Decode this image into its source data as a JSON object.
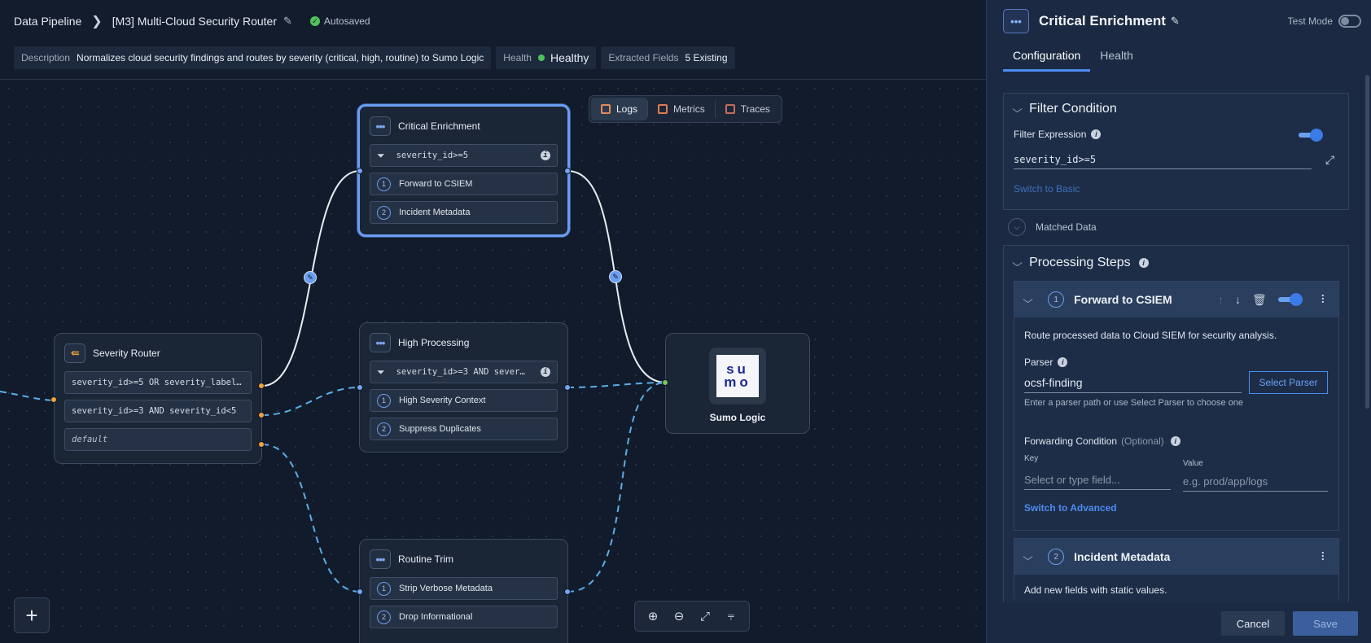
{
  "header": {
    "breadcrumb_root": "Data Pipeline",
    "pipeline_name": "[M3] Multi-Cloud Security Router",
    "autosaved": "Autosaved"
  },
  "info": {
    "description_label": "Description",
    "description": "Normalizes cloud security findings and routes by severity (critical, high, routine) to Sumo Logic",
    "health_label": "Health",
    "health_value": "Healthy",
    "fields_label": "Extracted Fields",
    "fields_value": "5 Existing"
  },
  "view_toggle": {
    "logs": "Logs",
    "metrics": "Metrics",
    "traces": "Traces",
    "selected": "Logs"
  },
  "nodes": {
    "critical": {
      "title": "Critical Enrichment",
      "filter": "severity_id>=5",
      "steps": [
        {
          "num": "1",
          "label": "Forward to CSIEM"
        },
        {
          "num": "2",
          "label": "Incident Metadata"
        }
      ]
    },
    "high": {
      "title": "High Processing",
      "filter": "severity_id>=3 AND sever…",
      "steps": [
        {
          "num": "1",
          "label": "High Severity Context"
        },
        {
          "num": "2",
          "label": "Suppress Duplicates"
        }
      ]
    },
    "routine": {
      "title": "Routine Trim",
      "steps": [
        {
          "num": "1",
          "label": "Strip Verbose Metadata"
        },
        {
          "num": "2",
          "label": "Drop Informational"
        }
      ]
    },
    "router": {
      "title": "Severity Router",
      "routes": [
        "severity_id>=5 OR severity_label…",
        "severity_id>=3 AND severity_id<5",
        "default"
      ]
    },
    "destination": {
      "logo_top": "su",
      "logo_bottom": "mo",
      "title": "Sumo Logic"
    }
  },
  "panel": {
    "title": "Critical Enrichment",
    "test_mode": "Test Mode",
    "tabs": [
      "Configuration",
      "Health"
    ],
    "filter_condition": {
      "title": "Filter Condition",
      "expression_label": "Filter Expression",
      "expression": "severity_id>=5",
      "switch_link": "Switch to Basic",
      "enabled": true
    },
    "matched_data": "Matched Data",
    "processing_steps": {
      "title": "Processing Steps",
      "step1": {
        "num": "1",
        "title": "Forward to CSIEM",
        "enabled": true,
        "description": "Route processed data to Cloud SIEM for security analysis.",
        "parser_label": "Parser",
        "parser_value": "ocsf-finding",
        "select_parser": "Select Parser",
        "parser_help": "Enter a parser path or use Select Parser to choose one",
        "forwarding_label": "Forwarding Condition",
        "optional": "(Optional)",
        "key_label": "Key",
        "key_placeholder": "Select or type field...",
        "value_label": "Value",
        "value_placeholder": "e.g. prod/app/logs",
        "switch_link": "Switch to Advanced"
      },
      "step2": {
        "num": "2",
        "title": "Incident Metadata",
        "description": "Add new fields with static values."
      }
    },
    "cancel": "Cancel",
    "save": "Save"
  }
}
